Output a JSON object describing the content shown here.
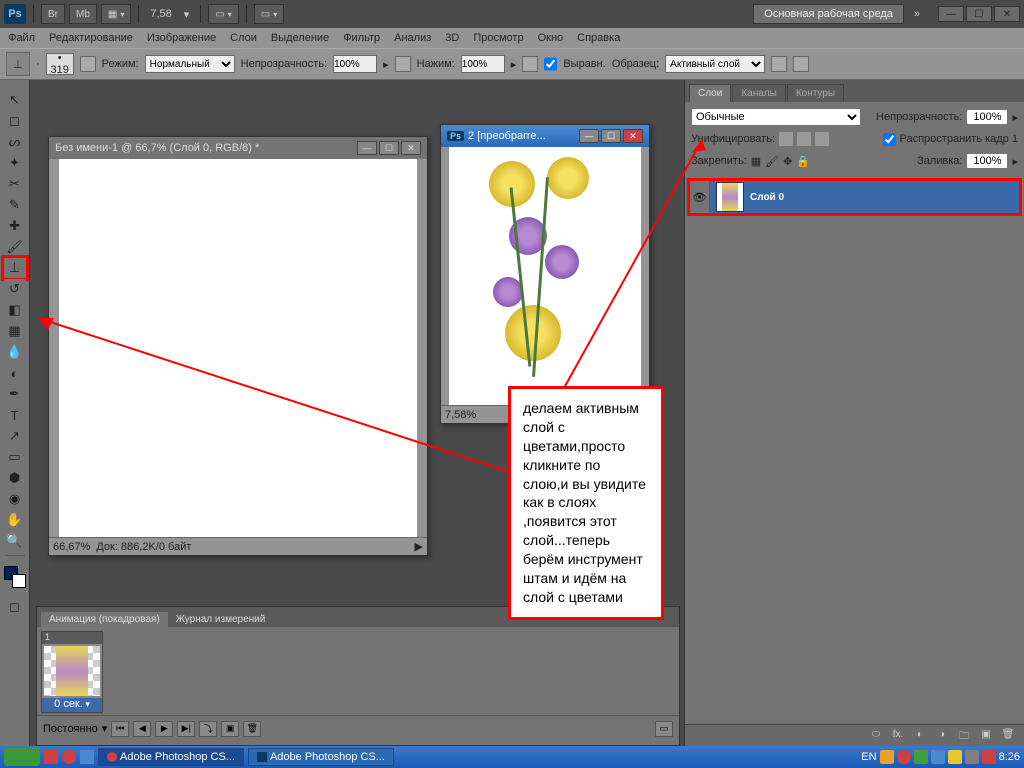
{
  "app_bar": {
    "br": "Br",
    "mb": "Mb",
    "zoom": "7,58",
    "workspace": "Основная рабочая среда"
  },
  "menu": [
    "Файл",
    "Редактирование",
    "Изображение",
    "Слои",
    "Выделение",
    "Фильтр",
    "Анализ",
    "3D",
    "Просмотр",
    "Окно",
    "Справка"
  ],
  "options": {
    "brush_size": "319",
    "mode_label": "Режим:",
    "mode": "Нормальный",
    "opacity_label": "Непрозрачность:",
    "opacity": "100%",
    "flow_label": "Нажим:",
    "flow": "100%",
    "aligned": "Выравн.",
    "sample_label": "Образец:",
    "sample": "Активный слой"
  },
  "doc1": {
    "title": "Без имени-1 @ 66,7% (Слой 0, RGB/8) *",
    "zoom": "66,67%",
    "status": "Док: 886,2K/0 байт"
  },
  "doc2": {
    "icon": "Ps",
    "title": "2 [преобрarre...",
    "zoom": "7,58%"
  },
  "layers": {
    "tabs": [
      "Слои",
      "Каналы",
      "Контуры"
    ],
    "blend": "Обычные",
    "opacity_label": "Непрозрачность:",
    "opacity": "100%",
    "unify": "Унифицировать:",
    "propagate": "Распространить кадр 1",
    "lock": "Закрепить:",
    "fill_label": "Заливка:",
    "fill": "100%",
    "layer0": "Слой 0"
  },
  "animation": {
    "tabs": [
      "Анимация (покадровая)",
      "Журнал измерений"
    ],
    "frame_num": "1",
    "frame_time": "0 сек.",
    "loop": "Постоянно"
  },
  "callout": "делаем активным слой с цветами,просто кликните по слою,и вы увидите как в слоях ,появится этот слой...теперь берём инструмент штам и идём на слой с цветами",
  "taskbar": {
    "t1": "Adobe Photoshop CS...",
    "t2": "Adobe Photoshop CS...",
    "lang": "EN",
    "time": "8:26"
  }
}
